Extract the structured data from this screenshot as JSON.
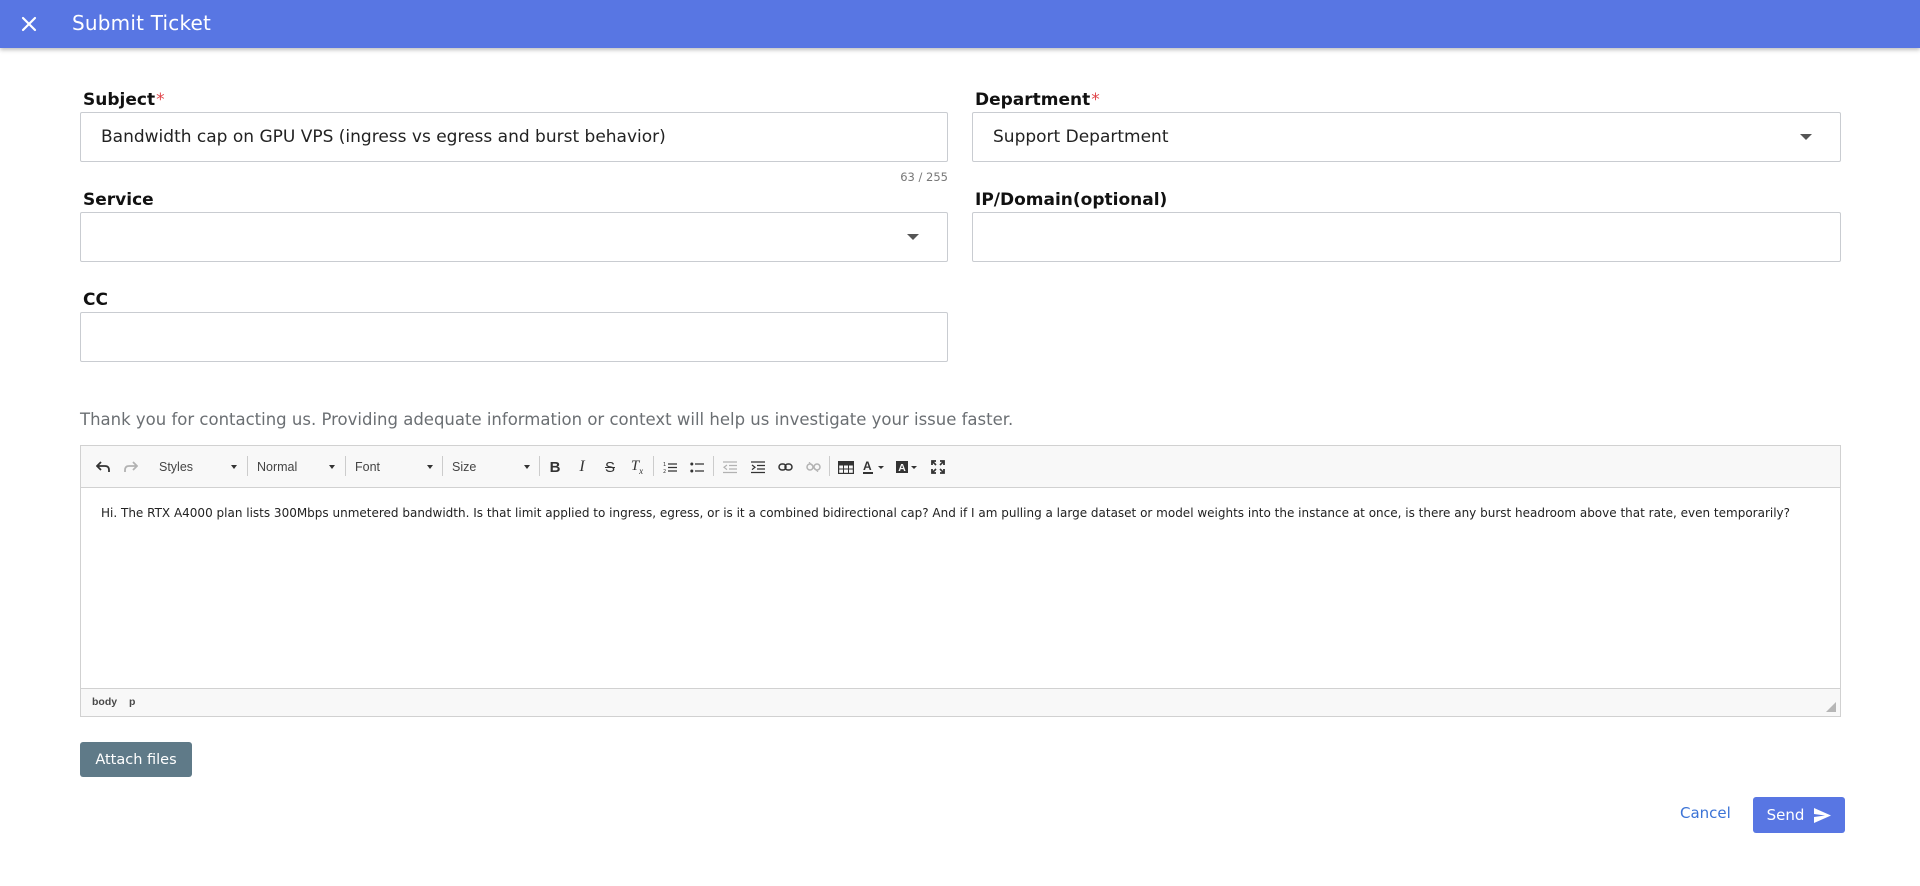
{
  "header": {
    "title": "Submit Ticket",
    "close_icon": "close-icon",
    "bg_color": "#5876e3"
  },
  "form": {
    "subject": {
      "label": "Subject",
      "required_mark": "*",
      "value": "Bandwidth cap on GPU VPS (ingress vs egress and burst behavior)",
      "counter": "63 / 255"
    },
    "department": {
      "label": "Department",
      "required_mark": "*",
      "value": "Support Department"
    },
    "service": {
      "label": "Service",
      "value": ""
    },
    "ip_domain": {
      "label": "IP/Domain(optional)",
      "value": ""
    },
    "cc": {
      "label": "CC",
      "value": ""
    },
    "hint": "Thank you for contacting us. Providing adequate information or context will help us investigate your issue faster."
  },
  "editor": {
    "toolbar": {
      "styles": "Styles",
      "format": "Normal",
      "font": "Font",
      "size": "Size",
      "icons": [
        "undo-icon",
        "redo-icon",
        "bold-icon",
        "italic-icon",
        "strikethrough-icon",
        "remove-format-icon",
        "numbered-list-icon",
        "bulleted-list-icon",
        "outdent-icon",
        "indent-icon",
        "link-icon",
        "unlink-icon",
        "table-icon",
        "text-color-icon",
        "background-color-icon",
        "maximize-icon"
      ]
    },
    "body_text": "Hi. The RTX A4000 plan lists 300Mbps unmetered bandwidth. Is that limit applied to ingress, egress, or is it a combined bidirectional cap? And if I am pulling a large dataset or model weights into the instance at once, is there any burst headroom above that rate, even temporarily?",
    "path": [
      "body",
      "p"
    ]
  },
  "actions": {
    "attach_label": "Attach files",
    "cancel_label": "Cancel",
    "send_label": "Send",
    "primary_color": "#5876e3",
    "attach_color": "#5f7a88"
  }
}
